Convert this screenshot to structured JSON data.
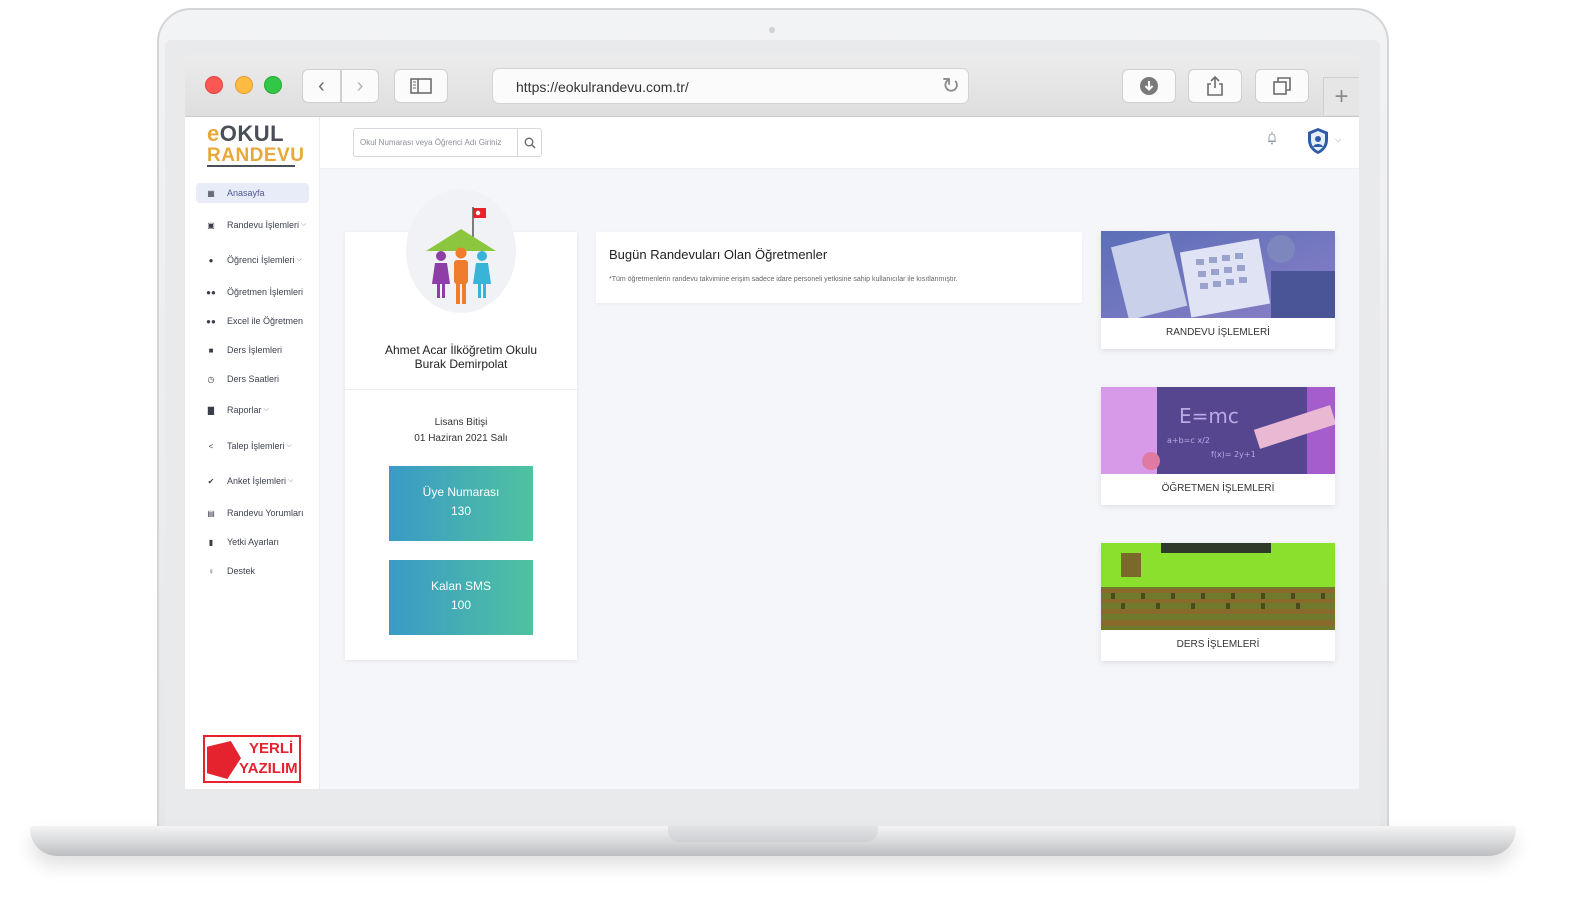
{
  "browser": {
    "url": "https://eokulrandevu.com.tr/"
  },
  "logo": {
    "line1": "OKUL",
    "line1_prefix": "e",
    "line2": "RANDEVU"
  },
  "search": {
    "placeholder": "Okul Numarası veya Öğrenci Adı Giriniz"
  },
  "sidebar": {
    "items": [
      {
        "label": "Anasayfa",
        "icon": "grid-icon",
        "active": true
      },
      {
        "label": "Randevu İşlemleri",
        "icon": "calendar-icon",
        "dropdown": true
      },
      {
        "label": "Öğrenci İşlemleri",
        "icon": "user-icon",
        "dropdown": true
      },
      {
        "label": "Öğretmen İşlemleri",
        "icon": "users-icon"
      },
      {
        "label": "Excel ile Öğretmen",
        "icon": "users-icon"
      },
      {
        "label": "Ders İşlemleri",
        "icon": "book-icon"
      },
      {
        "label": "Ders Saatleri",
        "icon": "clock-icon"
      },
      {
        "label": "Raporlar",
        "icon": "bar-chart-icon",
        "dropdown": true
      },
      {
        "label": "Talep İşlemleri",
        "icon": "share-icon",
        "dropdown": true
      },
      {
        "label": "Anket İşlemleri",
        "icon": "check-circle-icon",
        "dropdown": true
      },
      {
        "label": "Randevu Yorumları",
        "icon": "comment-icon"
      },
      {
        "label": "Yetki Ayarları",
        "icon": "lock-icon"
      },
      {
        "label": "Destek",
        "icon": "support-icon"
      }
    ],
    "badge": {
      "line1": "YERLİ",
      "line2": "YAZILIM"
    }
  },
  "profile": {
    "school": "Ahmet Acar İlköğretim Okulu",
    "person": "Burak Demirpolat",
    "license_label": "Lisans Bitişi",
    "license_date": "01 Haziran 2021 Salı",
    "stats": [
      {
        "label": "Üye Numarası",
        "value": "130"
      },
      {
        "label": "Kalan SMS",
        "value": "100"
      }
    ]
  },
  "teachers_panel": {
    "title": "Bugün Randevuları Olan Öğretmenler",
    "note": "*Tüm öğretmenlerin randevu takvimine erişim sadece idare personeli yetkisine sahip kullanıcılar ile kısıtlanmıştır."
  },
  "feature_cards": [
    {
      "label": "RANDEVU İŞLEMLERİ"
    },
    {
      "label": "ÖĞRETMEN İŞLEMLERİ"
    },
    {
      "label": "DERS İŞLEMLERİ"
    }
  ],
  "colors": {
    "accent": "#e8a83a",
    "stat_gradient_start": "#3a9ac6",
    "stat_gradient_end": "#4fc2a0",
    "badge_red": "#e4232e"
  }
}
